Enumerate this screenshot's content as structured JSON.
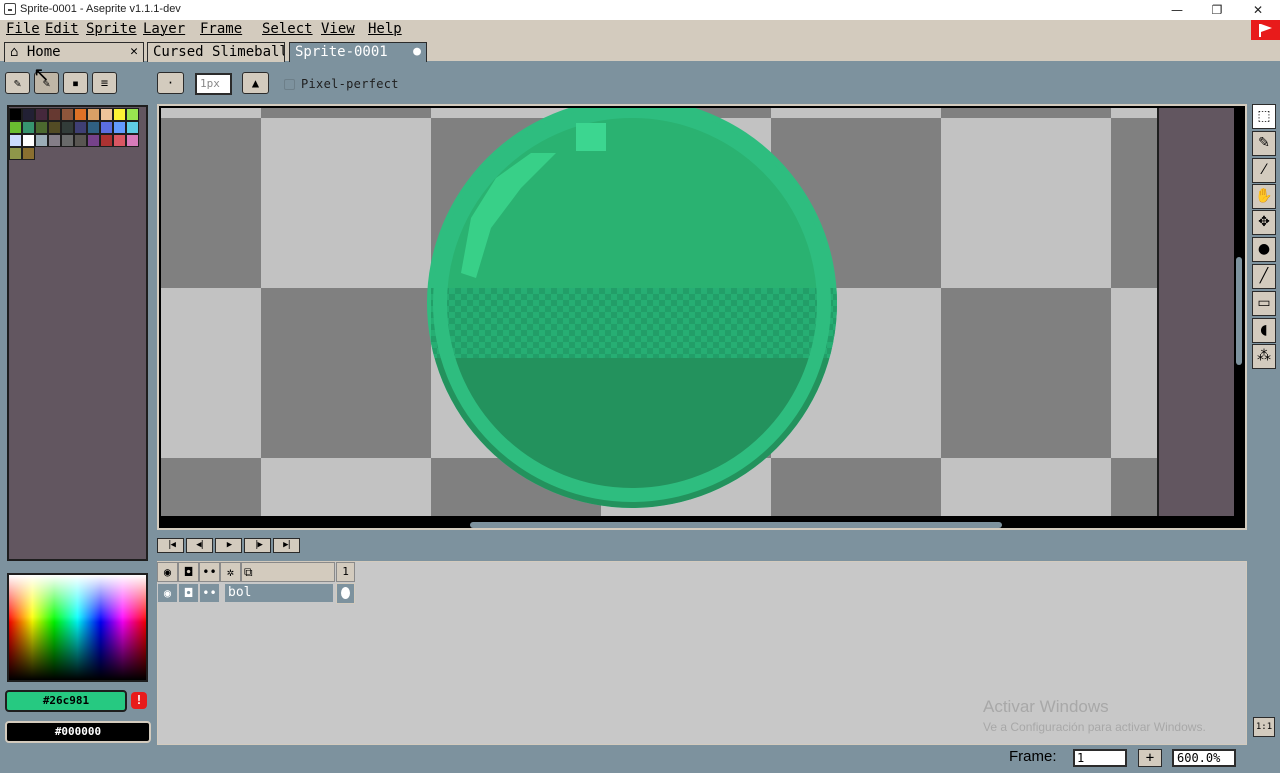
{
  "window": {
    "title": "Sprite-0001 - Aseprite v1.1.1-dev",
    "controls": {
      "minimize": "—",
      "restore": "❐",
      "close": "✕"
    }
  },
  "menubar": [
    "File",
    "Edit",
    "Sprite",
    "Layer",
    "Frame",
    "Select",
    "View",
    "Help"
  ],
  "tabs": [
    {
      "label": "Home",
      "close": "✕",
      "icon": "home-icon"
    },
    {
      "label": "Cursed Slimeball",
      "close": "✕"
    },
    {
      "label": "Sprite-0001",
      "modified_dot": "●"
    }
  ],
  "toolbar": {
    "brush_size": "1px",
    "pixel_perfect_label": "Pixel-perfect",
    "pixel_perfect_checked": false
  },
  "palette": {
    "colors": [
      "#000000",
      "#222034",
      "#45283c",
      "#663931",
      "#8f563b",
      "#df7126",
      "#d9a066",
      "#eec39a",
      "#fbf236",
      "#99e550",
      "#6abe30",
      "#37946e",
      "#4b692f",
      "#524b24",
      "#323c39",
      "#3f3f74",
      "#306082",
      "#5b6ee1",
      "#639bff",
      "#5fcde4",
      "#cbdbfc",
      "#ffffff",
      "#9badb7",
      "#847e87",
      "#696a6a",
      "#595652",
      "#76428a",
      "#ac3232",
      "#d95763",
      "#d77bba",
      "#8f974a",
      "#8a6f30"
    ]
  },
  "colors": {
    "foreground": "#26c981",
    "background": "#000000"
  },
  "tools": [
    "marquee-icon",
    "pencil-icon",
    "eyedropper-icon",
    "hand-icon",
    "move-icon",
    "paint-bucket-icon",
    "line-icon",
    "rectangle-icon",
    "blob-icon",
    "spray-icon"
  ],
  "timeline": {
    "frame_number": "1",
    "layers": [
      {
        "name": "bol"
      }
    ]
  },
  "watermark": {
    "title": "Activar Windows",
    "subtitle": "Ve a Configuración para activar Windows."
  },
  "status": {
    "frame_label": "Frame:",
    "frame_value": "1",
    "add_label": "+",
    "zoom": "600.0%",
    "one_to_one": "1:1"
  }
}
